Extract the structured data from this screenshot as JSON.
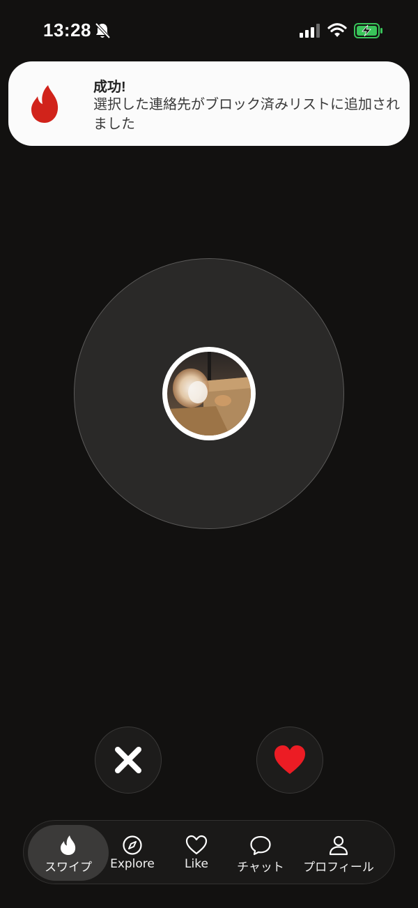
{
  "status_bar": {
    "time": "13:28",
    "icons": [
      "bell-slash-icon",
      "cellular-signal-icon",
      "wifi-icon",
      "battery-charging-icon"
    ],
    "battery_color": "#39c45a"
  },
  "notification": {
    "app_icon": "tinder-flame-icon",
    "title": "成功!",
    "body": "選択した連絡先がブロック済みリストに追加されました",
    "accent_color": "#d1231b"
  },
  "radar": {
    "avatar": "user-avatar-photo"
  },
  "actions": {
    "nope_icon": "close-icon",
    "like_icon": "heart-icon",
    "like_color": "#ec1c24"
  },
  "tab_bar": {
    "tabs": [
      {
        "label": "スワイプ",
        "icon": "flame-icon",
        "active": true
      },
      {
        "label": "Explore",
        "icon": "compass-icon",
        "active": false
      },
      {
        "label": "Like",
        "icon": "heart-outline-icon",
        "active": false
      },
      {
        "label": "チャット",
        "icon": "chat-bubble-icon",
        "active": false
      },
      {
        "label": "プロフィール",
        "icon": "person-icon",
        "active": false
      }
    ]
  }
}
